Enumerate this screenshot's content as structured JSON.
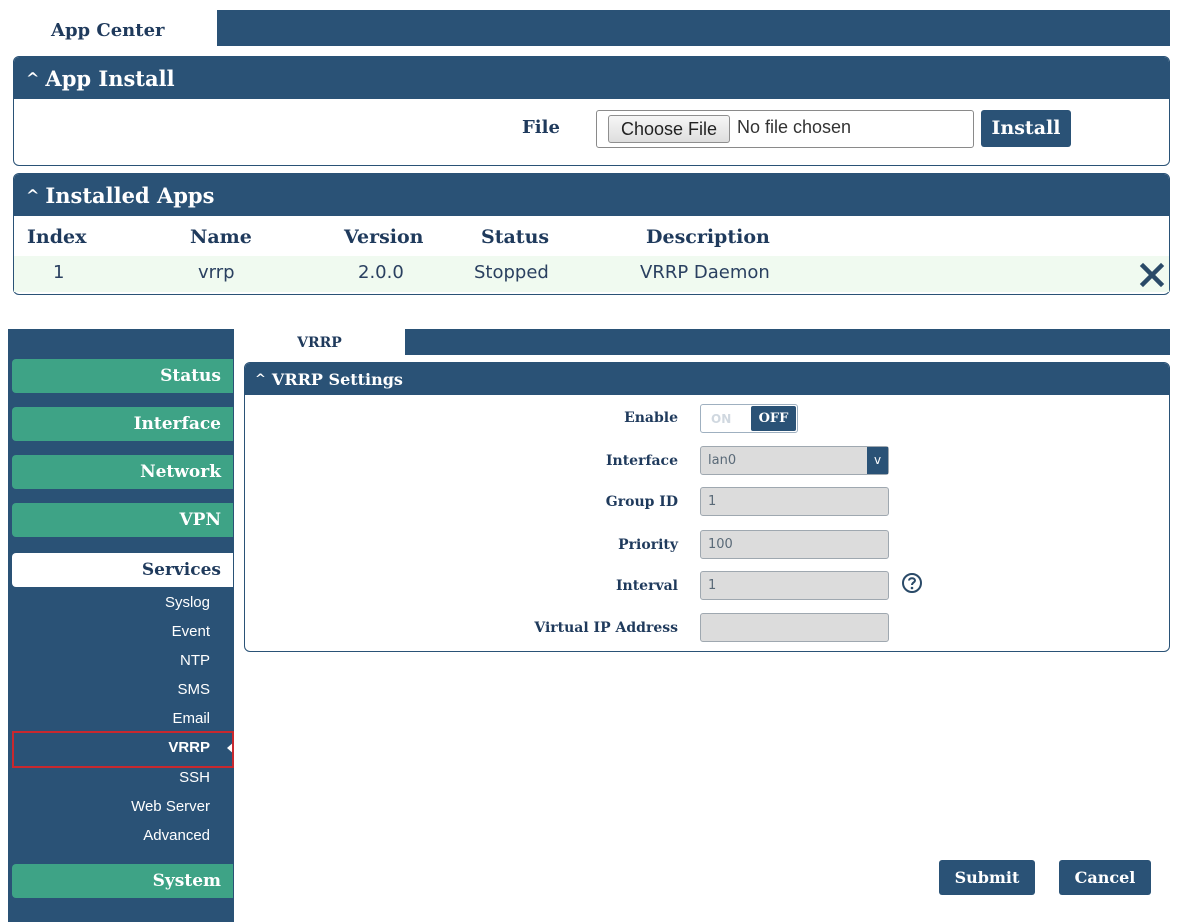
{
  "app_center": {
    "tab_label": "App Center",
    "install_section": {
      "title": "App Install",
      "file_label": "File",
      "choose_file_label": "Choose File",
      "no_file_text": "No file chosen",
      "install_label": "Install"
    },
    "installed_section": {
      "title": "Installed Apps",
      "columns": [
        "Index",
        "Name",
        "Version",
        "Status",
        "Description"
      ],
      "rows": [
        {
          "index": "1",
          "name": "vrrp",
          "version": "2.0.0",
          "status": "Stopped",
          "description": "VRRP Daemon"
        }
      ]
    }
  },
  "sidebar": {
    "items": [
      {
        "label": "Status"
      },
      {
        "label": "Interface"
      },
      {
        "label": "Network"
      },
      {
        "label": "VPN"
      },
      {
        "label": "Services"
      },
      {
        "label": "System"
      }
    ],
    "services_sub": [
      "Syslog",
      "Event",
      "NTP",
      "SMS",
      "Email",
      "VRRP",
      "SSH",
      "Web Server",
      "Advanced"
    ]
  },
  "vrrp_page": {
    "tab_label": "VRRP",
    "section_title": "VRRP Settings",
    "enable": {
      "label": "Enable",
      "on_text": "ON",
      "off_text": "OFF",
      "state": "OFF"
    },
    "interface": {
      "label": "Interface",
      "value": "lan0",
      "arrow": "v"
    },
    "group_id": {
      "label": "Group ID",
      "value": "1"
    },
    "priority": {
      "label": "Priority",
      "value": "100"
    },
    "interval": {
      "label": "Interval",
      "value": "1"
    },
    "virtual_ip": {
      "label": "Virtual IP Address",
      "value": ""
    },
    "submit_label": "Submit",
    "cancel_label": "Cancel"
  },
  "colors": {
    "header_blue": "#2a5276",
    "nav_green": "#3ea386",
    "highlight_red": "#c8282e"
  },
  "icons": {
    "delete": "close-icon",
    "help": "help-icon",
    "caret": "chevron-up-icon"
  }
}
